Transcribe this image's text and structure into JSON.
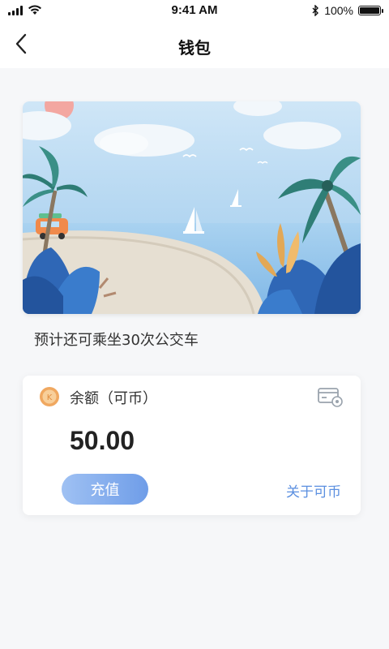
{
  "status": {
    "time": "9:41 AM",
    "battery": "100%"
  },
  "nav": {
    "title": "钱包"
  },
  "banner": {
    "hint": "预计还可乘坐30次公交车"
  },
  "wallet": {
    "balance_label": "余额（可币）",
    "balance": "50.00",
    "recharge_label": "充值",
    "about_label": "关于可币"
  },
  "colors": {
    "accent": "#5b8fe0",
    "button_start": "#9fc1f3",
    "button_end": "#6f9de8",
    "coin": "#f0a860"
  }
}
